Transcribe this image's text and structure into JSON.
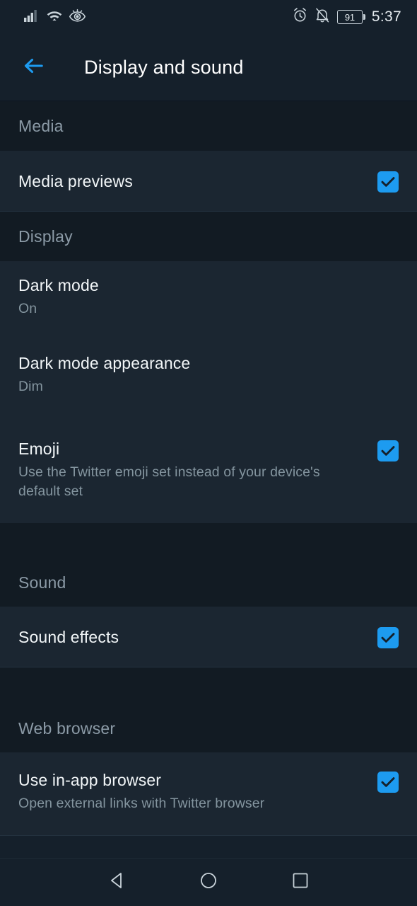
{
  "status_bar": {
    "icons_left": [
      "signal-bars-icon",
      "wifi-icon",
      "eye-comfort-icon"
    ],
    "icons_right": [
      "alarm-clock-icon",
      "notifications-muted-icon"
    ],
    "battery_level": "91",
    "time": "5:37"
  },
  "app_bar": {
    "back_label": "back-arrow",
    "title": "Display and sound",
    "accent_color": "#1d9bf0"
  },
  "sections": [
    {
      "header": "Media",
      "rows": [
        {
          "title": "Media previews",
          "subtitle": "",
          "checked": true
        }
      ]
    },
    {
      "header": "Display",
      "rows": [
        {
          "title": "Dark mode",
          "subtitle": "On",
          "checked": null
        },
        {
          "title": "Dark mode appearance",
          "subtitle": "Dim",
          "checked": null
        },
        {
          "title": "Emoji",
          "subtitle": "Use the Twitter emoji set instead of your device's default set",
          "checked": true
        }
      ]
    },
    {
      "header": "Sound",
      "rows": [
        {
          "title": "Sound effects",
          "subtitle": "",
          "checked": true
        }
      ]
    },
    {
      "header": "Web browser",
      "rows": [
        {
          "title": "Use in-app browser",
          "subtitle": "Open external links with Twitter browser",
          "checked": true
        }
      ]
    }
  ],
  "nav_bar": {
    "back": "nav-back-icon",
    "home": "nav-home-icon",
    "recents": "nav-recents-icon"
  },
  "colors": {
    "background": "#15202b",
    "row_background": "#1b2631",
    "section_background": "#121b23",
    "accent": "#1d9bf0",
    "primary_text": "#f2f6f8",
    "secondary_text": "#84959f"
  }
}
